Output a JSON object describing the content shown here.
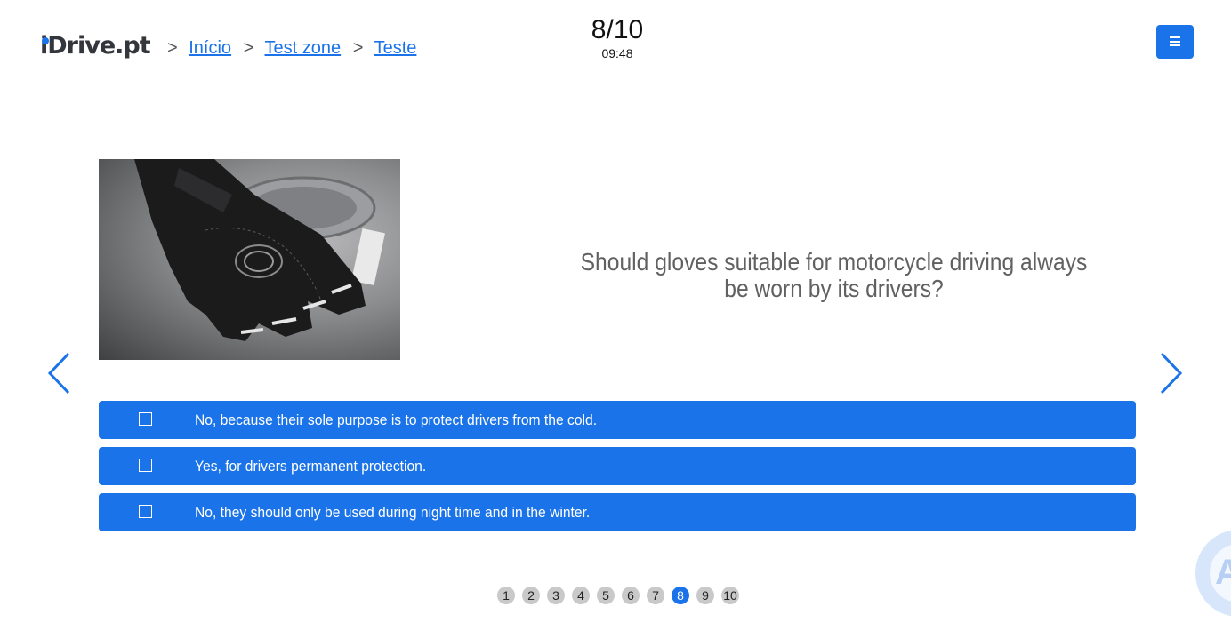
{
  "header": {
    "logo": {
      "i": "i",
      "rest": "Drive.pt"
    },
    "breadcrumb": {
      "separator": ">",
      "items": [
        "Início",
        "Test zone",
        "Teste"
      ]
    },
    "progress": {
      "counter": "8/10",
      "timer": "09:48"
    },
    "menu_icon": "hamburger-icon"
  },
  "question": {
    "image_subject": "motorcycle-glove-photo",
    "text": "Should gloves suitable for motorcycle driving always be worn by its drivers?",
    "answers": [
      {
        "label": "No, because their sole purpose is to protect drivers from the cold.",
        "checked": false
      },
      {
        "label": "Yes, for drivers permanent protection.",
        "checked": false
      },
      {
        "label": "No, they should only be used during night time and in the winter.",
        "checked": false
      }
    ]
  },
  "navigation": {
    "prev_icon": "chevron-left-icon",
    "next_icon": "chevron-right-icon"
  },
  "pager": {
    "pages": [
      "1",
      "2",
      "3",
      "4",
      "5",
      "6",
      "7",
      "8",
      "9",
      "10"
    ],
    "current": "8"
  },
  "widget": {
    "icon": "accessibility-icon",
    "glyph": "A"
  },
  "colors": {
    "accent": "#1a73e8",
    "question_text": "#616161",
    "page_dot": "#c9c9c9"
  }
}
